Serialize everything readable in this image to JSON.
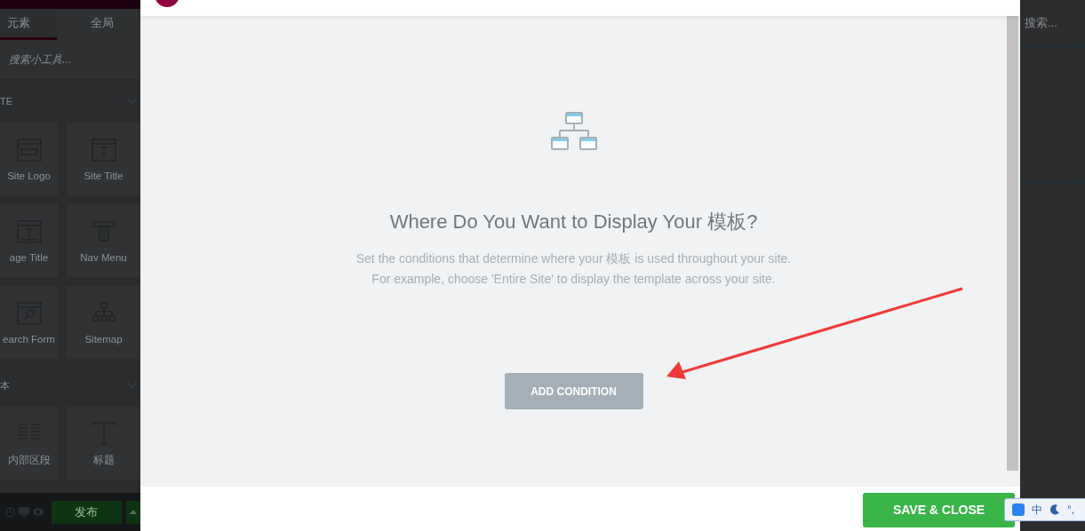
{
  "editor_panel": {
    "tabs": [
      {
        "label": "元素",
        "selected": true
      },
      {
        "label": "全局",
        "selected": false
      }
    ],
    "search": {
      "placeholder": "搜索小工具..."
    },
    "sections": [
      {
        "title": "TE",
        "widgets": [
          {
            "label": "Site Logo",
            "kind": "logo"
          },
          {
            "label": "Site Title",
            "kind": "title"
          },
          {
            "label": "age Title",
            "kind": "page-title"
          },
          {
            "label": "Nav Menu",
            "kind": "menu"
          },
          {
            "label": "earch Form",
            "kind": "search"
          },
          {
            "label": "Sitemap",
            "kind": "sitemap"
          }
        ]
      },
      {
        "title": "本",
        "widgets": [
          {
            "label": "内部区段",
            "kind": "section"
          },
          {
            "label": "标题",
            "kind": "heading"
          }
        ]
      }
    ],
    "publish_button": "发布"
  },
  "preview_panel": {
    "search": {
      "placeholder": "搜索..."
    }
  },
  "modal": {
    "heading": "Where Do You Want to Display Your 模板?",
    "description": [
      "Set the conditions that determine where your 模板 is used throughout your site.",
      "For example, choose 'Entire Site' to display the template across your site."
    ],
    "add_button": "ADD CONDITION",
    "save_button": "SAVE & CLOSE"
  },
  "ime_toolbar": {
    "mode": "中",
    "punctuation": "°,"
  }
}
